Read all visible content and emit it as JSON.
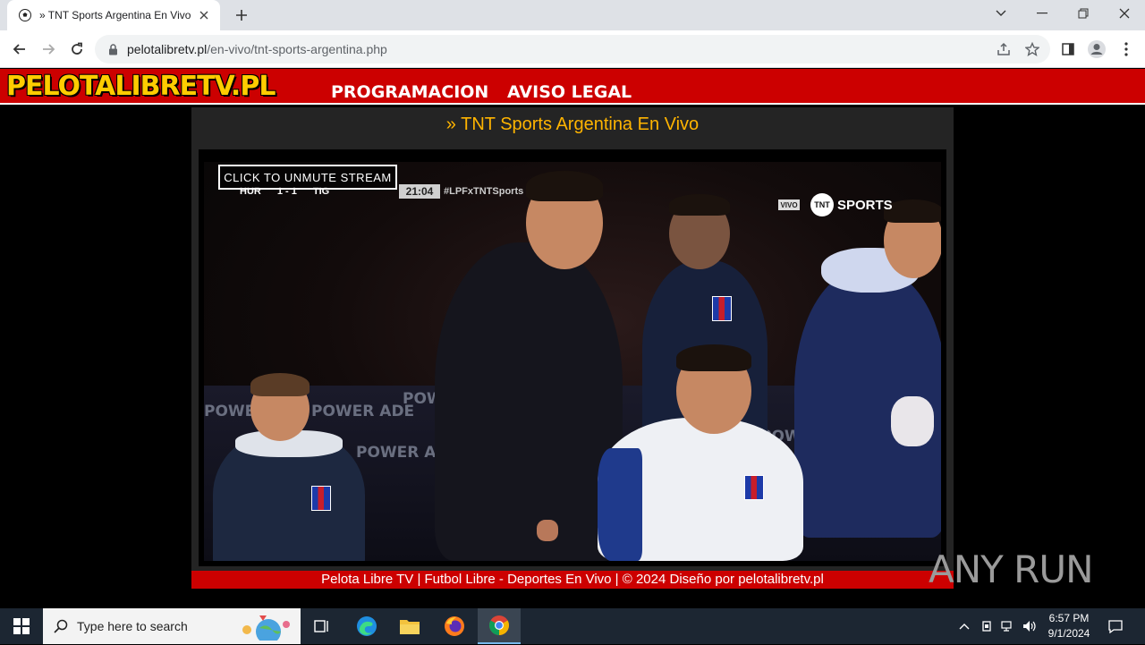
{
  "browser": {
    "tab_title": "» TNT Sports Argentina En Vivo | ",
    "url_host": "pelotalibretv.pl",
    "url_path": "/en-vivo/tnt-sports-argentina.php"
  },
  "site": {
    "logo": "PELOTALIBRETV.PL",
    "menu": [
      "PROGRAMACION",
      "AVISO LEGAL"
    ],
    "heading": "» TNT Sports Argentina En Vivo",
    "footer": "Pelota Libre TV | Futbol Libre - Deportes En Vivo | © 2024 Diseño por pelotalibretv.pl"
  },
  "player": {
    "overlay_button": "CLICK TO UNMUTE STREAM",
    "score_home": "HUR",
    "score_away": "TIG",
    "score_result": "1 - 1",
    "clock": "21:04",
    "hashtag": "#LPFxTNTSports",
    "live_badge": "VIVO",
    "channel": "SPORTS",
    "channel_mark": "TNT",
    "board_text": "POWER ADE"
  },
  "watermark": "ANY RUN",
  "taskbar": {
    "search_placeholder": "Type here to search",
    "time": "6:57 PM",
    "date": "9/1/2024"
  },
  "colors": {
    "site_red": "#cc0000",
    "logo_yellow": "#ffcc00",
    "heading_orange": "#ffb400",
    "content_bg": "#242424"
  }
}
